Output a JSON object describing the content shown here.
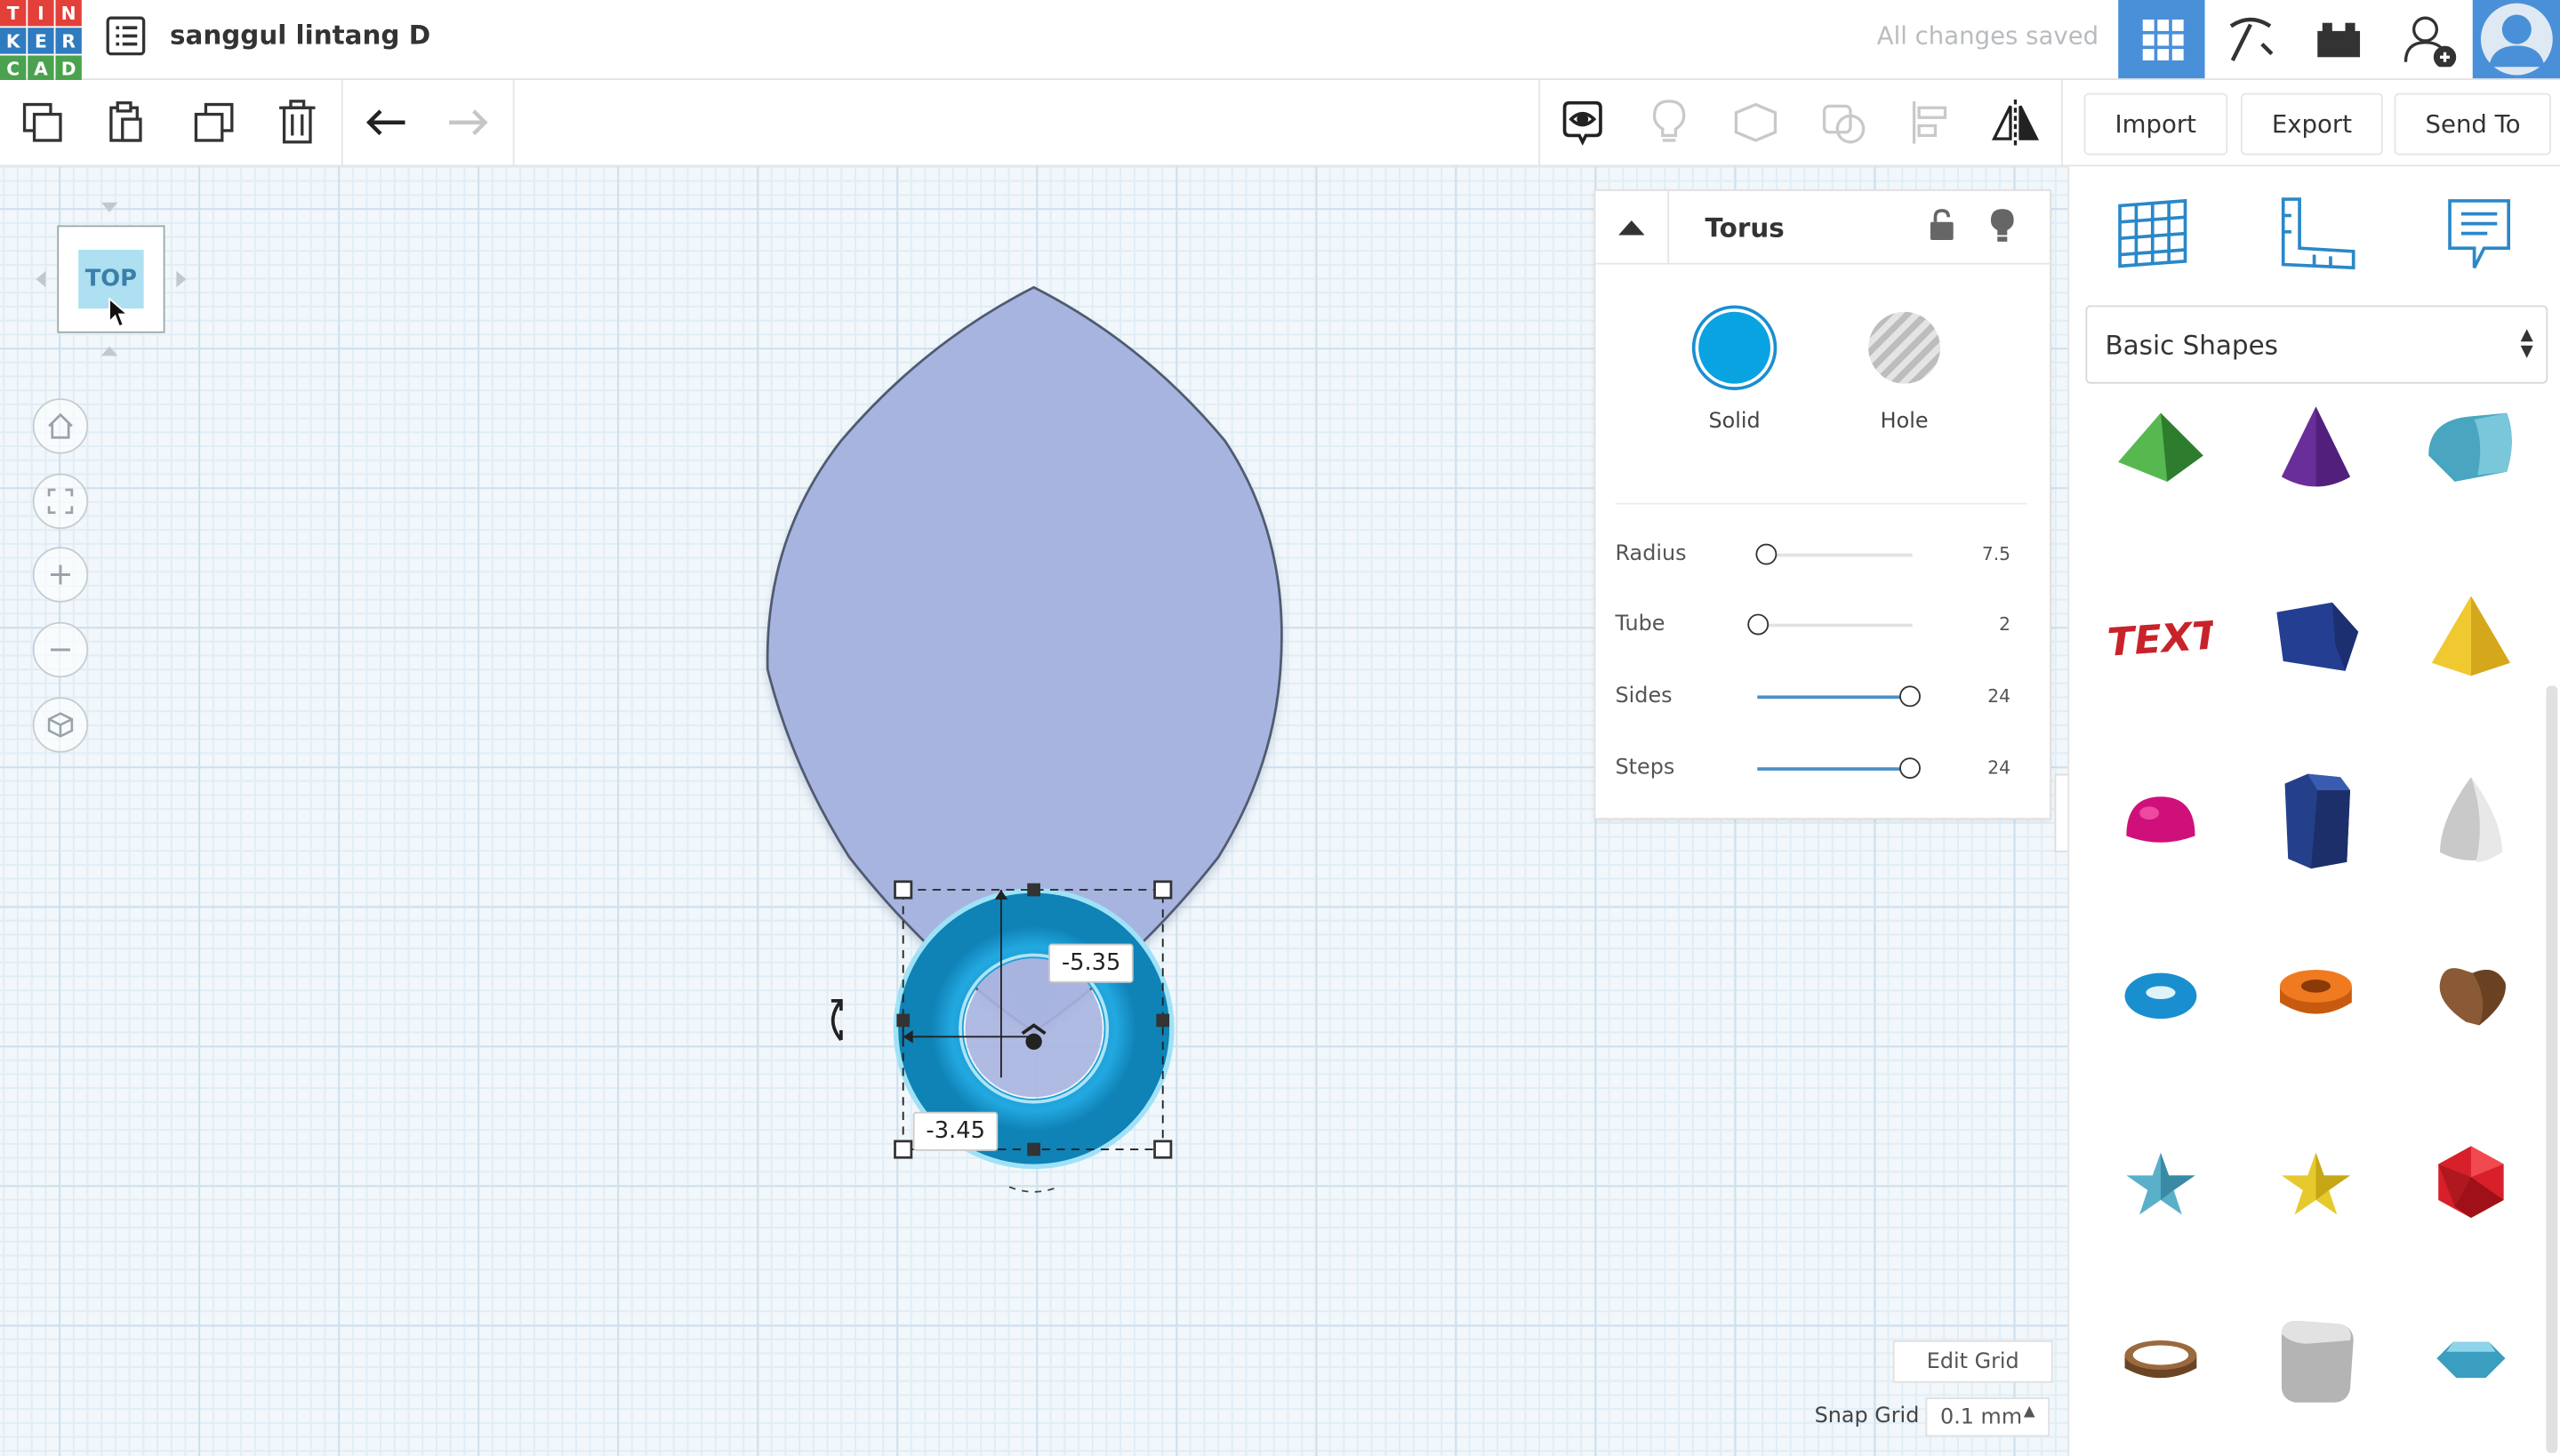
{
  "app": {
    "logo_letters": [
      "T",
      "I",
      "N",
      "K",
      "E",
      "R",
      "C",
      "A",
      "D"
    ],
    "logo_colors": [
      "#e4403a",
      "#e4403a",
      "#e4403a",
      "#2f7bbf",
      "#2f7bbf",
      "#2f7bbf",
      "#4aa24e",
      "#4aa24e",
      "#4aa24e"
    ],
    "design_title": "sanggul lintang D",
    "save_status": "All changes saved",
    "accent": "#1f93d6"
  },
  "top_icons": [
    "3d-design-grid-icon",
    "pickaxe-icon",
    "bricks-icon",
    "add-user-icon",
    "avatar-icon"
  ],
  "toolbar": {
    "left_icons": [
      "copy-icon",
      "paste-icon",
      "duplicate-icon",
      "delete-icon",
      "undo-icon",
      "redo-icon"
    ],
    "right_icons": [
      "show-all-icon",
      "hint-bulb-icon",
      "group-icon",
      "ungroup-icon",
      "align-icon",
      "mirror-icon"
    ],
    "import_label": "Import",
    "export_label": "Export",
    "send_to_label": "Send To"
  },
  "viewcube": {
    "face_label": "TOP"
  },
  "nav_controls": [
    "home-view-icon",
    "fit-view-icon",
    "zoom-in-icon",
    "zoom-out-icon",
    "perspective-icon"
  ],
  "canvas": {
    "dim_x": "-5.35",
    "dim_y": "-3.45",
    "shape_color": "#a8b4e0",
    "torus_color": "#19a1d9"
  },
  "inspector": {
    "shape_name": "Torus",
    "solid_label": "Solid",
    "hole_label": "Hole",
    "params": [
      {
        "label": "Radius",
        "value": "7.5",
        "fraction": 0.05
      },
      {
        "label": "Tube",
        "value": "2",
        "fraction": 0.0
      },
      {
        "label": "Sides",
        "value": "24",
        "fraction": 0.98
      },
      {
        "label": "Steps",
        "value": "24",
        "fraction": 0.98
      }
    ]
  },
  "right_panel": {
    "top_icons": [
      "workplane-icon",
      "ruler-icon",
      "notes-icon"
    ],
    "library": "Basic Shapes",
    "shapes": [
      "roof-shape-icon",
      "cone-shape-icon",
      "half-cylinder-shape-icon",
      "text-shape-icon",
      "polygon-shape-icon",
      "pyramid-shape-icon",
      "hemisphere-shape-icon",
      "hexagonal-prism-shape-icon",
      "paraboloid-shape-icon",
      "torus-shape-icon",
      "tube-shape-icon",
      "heart-shape-icon",
      "star-shape-icon",
      "star-yellow-shape-icon",
      "icosahedron-shape-icon",
      "ring-shape-icon",
      "rounded-box-shape-icon",
      "diamond-shape-icon"
    ],
    "text_shape_label": "TEXT"
  },
  "bottom": {
    "edit_grid_label": "Edit Grid",
    "snap_grid_label": "Snap Grid",
    "snap_grid_value": "0.1 mm"
  }
}
